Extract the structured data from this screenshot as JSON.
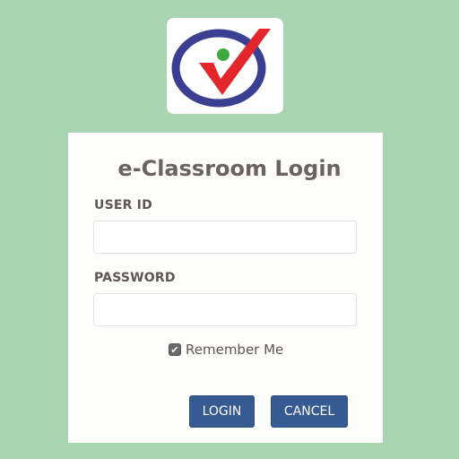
{
  "logo": {
    "icon": "check-mark-logo",
    "colors": {
      "ring": "#3a3f91",
      "check": "#e3262b",
      "dot": "#3fa83f"
    }
  },
  "login": {
    "title": "e-Classroom Login",
    "user_id_label": "USER ID",
    "user_id_value": "",
    "password_label": "PASSWORD",
    "password_value": "",
    "remember_label": "Remember Me",
    "remember_checked": true,
    "login_label": "LOGIN",
    "cancel_label": "CANCEL"
  },
  "colors": {
    "background": "#a9d4b2",
    "card": "#fdfdfb",
    "button": "#375a93",
    "label": "#5f5656"
  }
}
